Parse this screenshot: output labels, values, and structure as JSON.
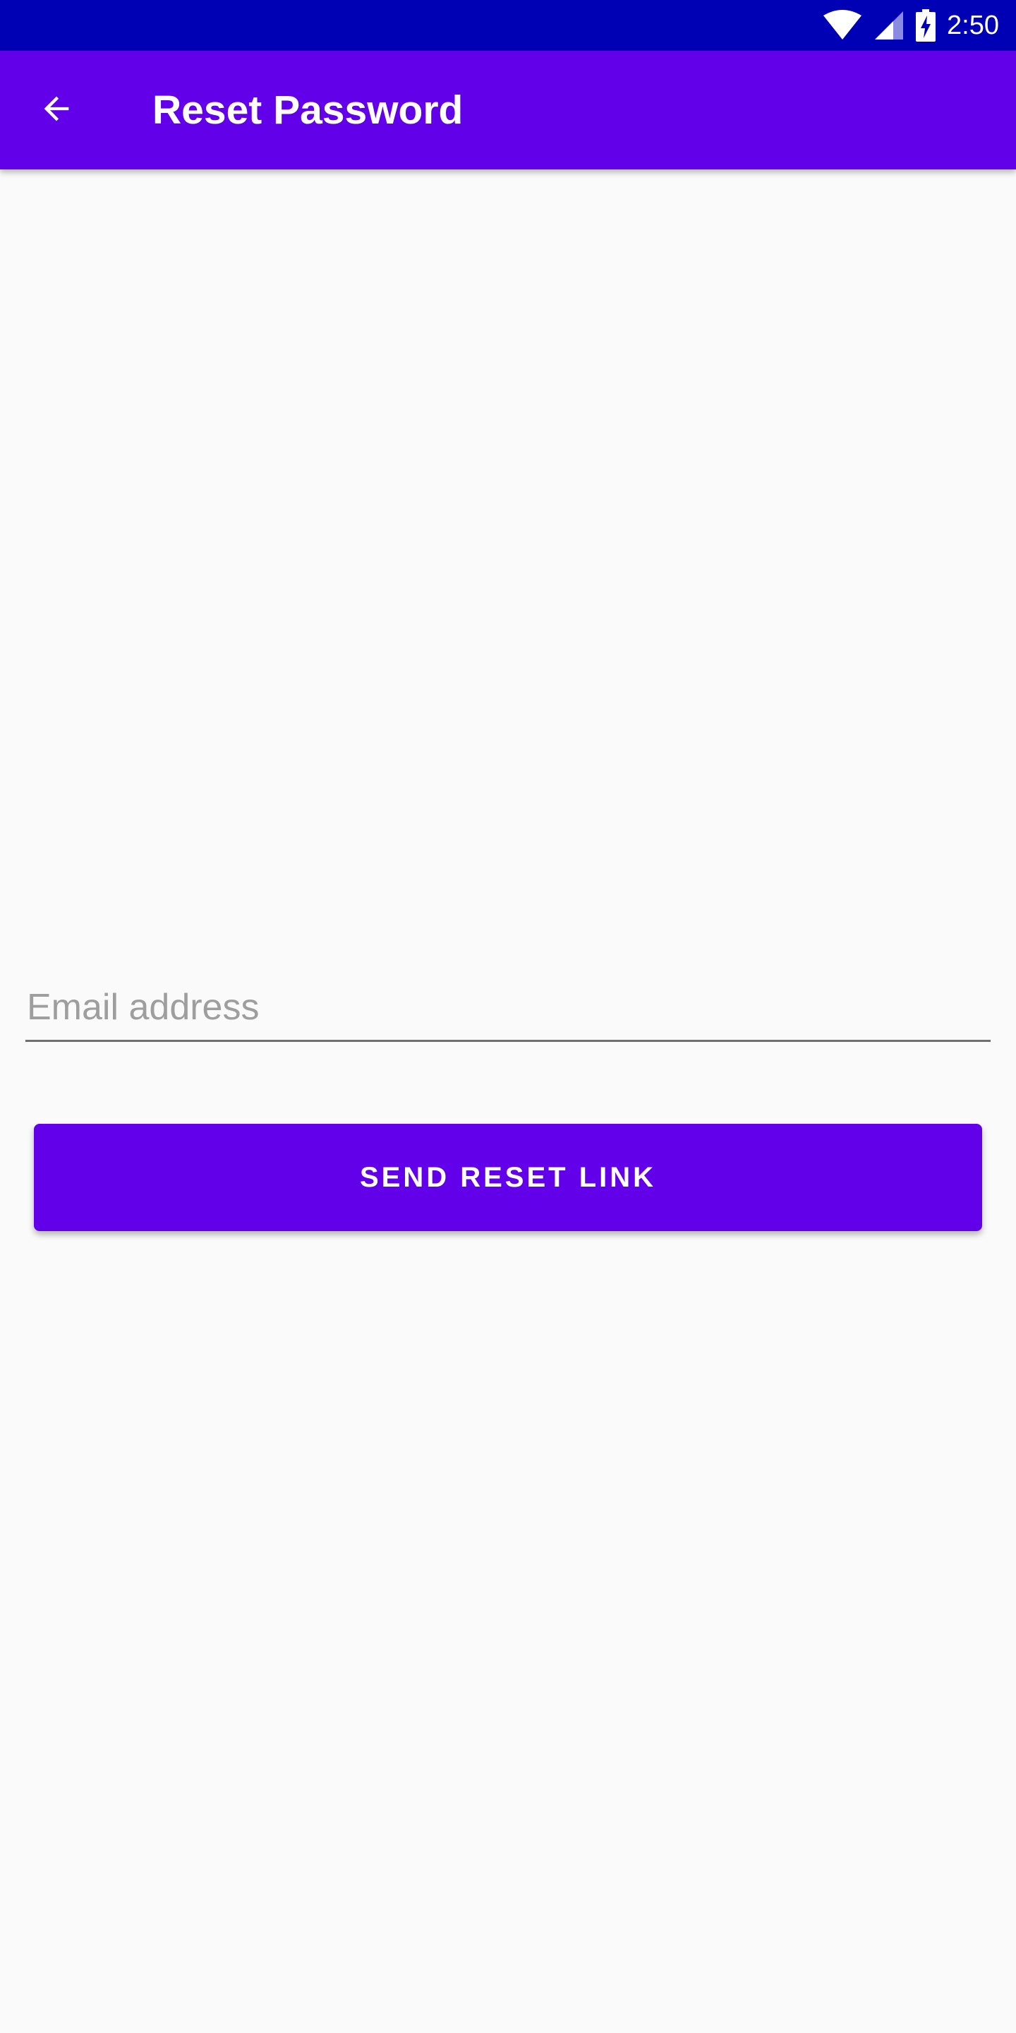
{
  "status_bar": {
    "time": "2:50",
    "background_color": "#0000b5",
    "icons": [
      "wifi-icon",
      "signal-icon",
      "battery-charging-icon"
    ]
  },
  "app_bar": {
    "title": "Reset Password",
    "background_color": "#6200ea",
    "back_icon": "arrow-back-icon"
  },
  "form": {
    "email": {
      "value": "",
      "placeholder": "Email address"
    },
    "send_button": {
      "label": "SEND RESET LINK",
      "color": "#6200ea"
    }
  }
}
